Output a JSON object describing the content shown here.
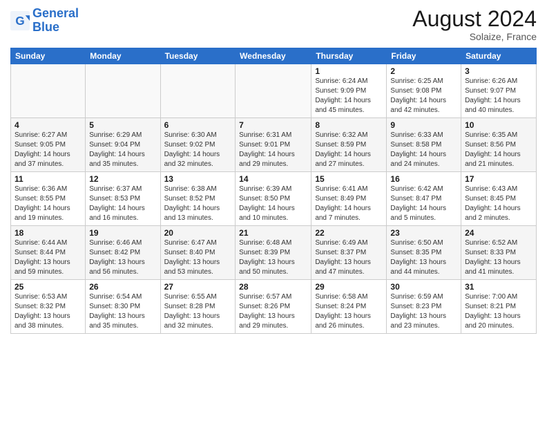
{
  "logo": {
    "text_general": "General",
    "text_blue": "Blue"
  },
  "header": {
    "title": "August 2024",
    "subtitle": "Solaize, France"
  },
  "weekdays": [
    "Sunday",
    "Monday",
    "Tuesday",
    "Wednesday",
    "Thursday",
    "Friday",
    "Saturday"
  ],
  "weeks": [
    [
      {
        "day": "",
        "info": ""
      },
      {
        "day": "",
        "info": ""
      },
      {
        "day": "",
        "info": ""
      },
      {
        "day": "",
        "info": ""
      },
      {
        "day": "1",
        "info": "Sunrise: 6:24 AM\nSunset: 9:09 PM\nDaylight: 14 hours and 45 minutes."
      },
      {
        "day": "2",
        "info": "Sunrise: 6:25 AM\nSunset: 9:08 PM\nDaylight: 14 hours and 42 minutes."
      },
      {
        "day": "3",
        "info": "Sunrise: 6:26 AM\nSunset: 9:07 PM\nDaylight: 14 hours and 40 minutes."
      }
    ],
    [
      {
        "day": "4",
        "info": "Sunrise: 6:27 AM\nSunset: 9:05 PM\nDaylight: 14 hours and 37 minutes."
      },
      {
        "day": "5",
        "info": "Sunrise: 6:29 AM\nSunset: 9:04 PM\nDaylight: 14 hours and 35 minutes."
      },
      {
        "day": "6",
        "info": "Sunrise: 6:30 AM\nSunset: 9:02 PM\nDaylight: 14 hours and 32 minutes."
      },
      {
        "day": "7",
        "info": "Sunrise: 6:31 AM\nSunset: 9:01 PM\nDaylight: 14 hours and 29 minutes."
      },
      {
        "day": "8",
        "info": "Sunrise: 6:32 AM\nSunset: 8:59 PM\nDaylight: 14 hours and 27 minutes."
      },
      {
        "day": "9",
        "info": "Sunrise: 6:33 AM\nSunset: 8:58 PM\nDaylight: 14 hours and 24 minutes."
      },
      {
        "day": "10",
        "info": "Sunrise: 6:35 AM\nSunset: 8:56 PM\nDaylight: 14 hours and 21 minutes."
      }
    ],
    [
      {
        "day": "11",
        "info": "Sunrise: 6:36 AM\nSunset: 8:55 PM\nDaylight: 14 hours and 19 minutes."
      },
      {
        "day": "12",
        "info": "Sunrise: 6:37 AM\nSunset: 8:53 PM\nDaylight: 14 hours and 16 minutes."
      },
      {
        "day": "13",
        "info": "Sunrise: 6:38 AM\nSunset: 8:52 PM\nDaylight: 14 hours and 13 minutes."
      },
      {
        "day": "14",
        "info": "Sunrise: 6:39 AM\nSunset: 8:50 PM\nDaylight: 14 hours and 10 minutes."
      },
      {
        "day": "15",
        "info": "Sunrise: 6:41 AM\nSunset: 8:49 PM\nDaylight: 14 hours and 7 minutes."
      },
      {
        "day": "16",
        "info": "Sunrise: 6:42 AM\nSunset: 8:47 PM\nDaylight: 14 hours and 5 minutes."
      },
      {
        "day": "17",
        "info": "Sunrise: 6:43 AM\nSunset: 8:45 PM\nDaylight: 14 hours and 2 minutes."
      }
    ],
    [
      {
        "day": "18",
        "info": "Sunrise: 6:44 AM\nSunset: 8:44 PM\nDaylight: 13 hours and 59 minutes."
      },
      {
        "day": "19",
        "info": "Sunrise: 6:46 AM\nSunset: 8:42 PM\nDaylight: 13 hours and 56 minutes."
      },
      {
        "day": "20",
        "info": "Sunrise: 6:47 AM\nSunset: 8:40 PM\nDaylight: 13 hours and 53 minutes."
      },
      {
        "day": "21",
        "info": "Sunrise: 6:48 AM\nSunset: 8:39 PM\nDaylight: 13 hours and 50 minutes."
      },
      {
        "day": "22",
        "info": "Sunrise: 6:49 AM\nSunset: 8:37 PM\nDaylight: 13 hours and 47 minutes."
      },
      {
        "day": "23",
        "info": "Sunrise: 6:50 AM\nSunset: 8:35 PM\nDaylight: 13 hours and 44 minutes."
      },
      {
        "day": "24",
        "info": "Sunrise: 6:52 AM\nSunset: 8:33 PM\nDaylight: 13 hours and 41 minutes."
      }
    ],
    [
      {
        "day": "25",
        "info": "Sunrise: 6:53 AM\nSunset: 8:32 PM\nDaylight: 13 hours and 38 minutes."
      },
      {
        "day": "26",
        "info": "Sunrise: 6:54 AM\nSunset: 8:30 PM\nDaylight: 13 hours and 35 minutes."
      },
      {
        "day": "27",
        "info": "Sunrise: 6:55 AM\nSunset: 8:28 PM\nDaylight: 13 hours and 32 minutes."
      },
      {
        "day": "28",
        "info": "Sunrise: 6:57 AM\nSunset: 8:26 PM\nDaylight: 13 hours and 29 minutes."
      },
      {
        "day": "29",
        "info": "Sunrise: 6:58 AM\nSunset: 8:24 PM\nDaylight: 13 hours and 26 minutes."
      },
      {
        "day": "30",
        "info": "Sunrise: 6:59 AM\nSunset: 8:23 PM\nDaylight: 13 hours and 23 minutes."
      },
      {
        "day": "31",
        "info": "Sunrise: 7:00 AM\nSunset: 8:21 PM\nDaylight: 13 hours and 20 minutes."
      }
    ]
  ]
}
